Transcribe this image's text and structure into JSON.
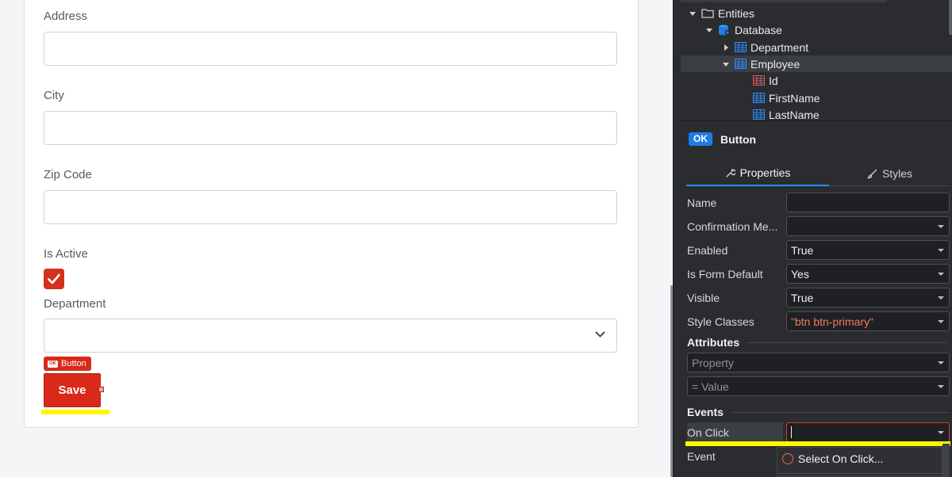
{
  "form": {
    "fields": [
      {
        "label": "Address",
        "value": ""
      },
      {
        "label": "City",
        "value": ""
      },
      {
        "label": "Zip Code",
        "value": ""
      }
    ],
    "is_active_label": "Is Active",
    "is_active_checked": true,
    "department_label": "Department",
    "department_value": "",
    "selected_tag": "Button",
    "selected_tag_icon_text": "OK",
    "save_label": "Save"
  },
  "tree": {
    "items": [
      {
        "label": "Entities",
        "icon": "folder-icon",
        "expanded": true
      },
      {
        "label": "Database",
        "icon": "database-icon",
        "expanded": true
      },
      {
        "label": "Department",
        "icon": "table-icon",
        "expanded": false
      },
      {
        "label": "Employee",
        "icon": "table-icon",
        "expanded": true,
        "selected": true
      },
      {
        "label": "Id",
        "icon": "key-column-icon"
      },
      {
        "label": "FirstName",
        "icon": "column-icon"
      },
      {
        "label": "LastName",
        "icon": "column-icon"
      }
    ]
  },
  "component": {
    "badge": "OK",
    "name": "Button"
  },
  "tabs": [
    {
      "label": "Properties",
      "icon": "wrench-icon",
      "active": true
    },
    {
      "label": "Styles",
      "icon": "brush-icon",
      "active": false
    }
  ],
  "properties": [
    {
      "label": "Name",
      "value": "",
      "type": "input"
    },
    {
      "label": "Confirmation Me...",
      "value": "",
      "type": "select"
    },
    {
      "label": "Enabled",
      "value": "True",
      "type": "select"
    },
    {
      "label": "Is Form Default",
      "value": "Yes",
      "type": "select"
    },
    {
      "label": "Visible",
      "value": "True",
      "type": "select"
    },
    {
      "label": "Style Classes",
      "value": "\"btn btn-primary\"",
      "type": "select"
    }
  ],
  "attributes": {
    "title": "Attributes",
    "property_placeholder": "Property",
    "value_placeholder": "= Value"
  },
  "events": {
    "title": "Events",
    "on_click_label": "On Click",
    "on_click_value": "",
    "event_label": "Event",
    "dropdown_option": "Select On Click..."
  },
  "colors": {
    "accent": "#d9291a",
    "highlight": "#fff700",
    "badge_blue": "#1e7de4",
    "panel_bg": "#2a2c2f"
  }
}
